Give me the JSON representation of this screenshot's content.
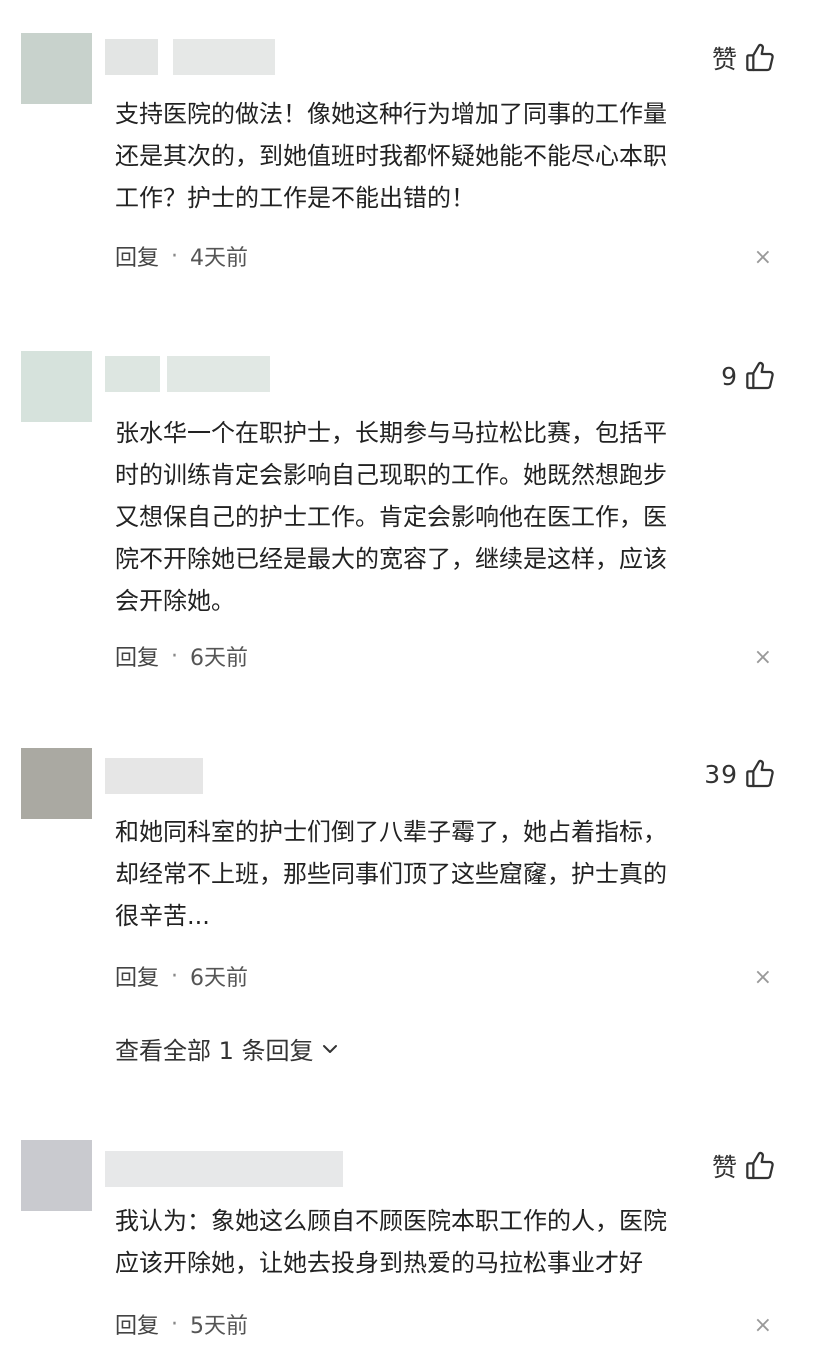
{
  "colors": {
    "avatar_1": "#c8d2cc",
    "avatar_2": "#d6e2dc",
    "avatar_3": "#aaa9a2",
    "avatar_4": "#c9cacf",
    "name_bar": "#e5e7e6",
    "name_bar_dark": "#dde1df"
  },
  "comments": [
    {
      "like_label": "赞",
      "lines": [
        "支持医院的做法！像她这种行为增加了同事的工作量",
        "还是其次的，到她值班时我都怀疑她能不能尽心本职",
        "工作？护士的工作是不能出错的！"
      ],
      "reply_label": "回复",
      "dot": "·",
      "time": "4天前",
      "close": "×"
    },
    {
      "like_label": "9",
      "lines": [
        "张水华一个在职护士，长期参与马拉松比赛，包括平",
        "时的训练肯定会影响自己现职的工作。她既然想跑步",
        "又想保自己的护士工作。肯定会影响他在医工作，医",
        "院不开除她已经是最大的宽容了，继续是这样，应该",
        "会开除她。"
      ],
      "reply_label": "回复",
      "dot": "·",
      "time": "6天前",
      "close": "×"
    },
    {
      "like_label": "39",
      "lines": [
        "和她同科室的护士们倒了八辈子霉了，她占着指标，",
        "却经常不上班，那些同事们顶了这些窟窿，护士真的",
        "很辛苦..."
      ],
      "reply_label": "回复",
      "dot": "·",
      "time": "6天前",
      "close": "×",
      "view_replies": "查看全部 1 条回复"
    },
    {
      "like_label": "赞",
      "lines": [
        "我认为：象她这么顾自不顾医院本职工作的人，医院",
        "应该开除她，让她去投身到热爱的马拉松事业才好"
      ],
      "reply_label": "回复",
      "dot": "·",
      "time": "5天前",
      "close": "×"
    }
  ],
  "icons": {
    "like": "thumbs-up-icon",
    "expand": "chevron-down-icon",
    "close": "close-icon"
  }
}
